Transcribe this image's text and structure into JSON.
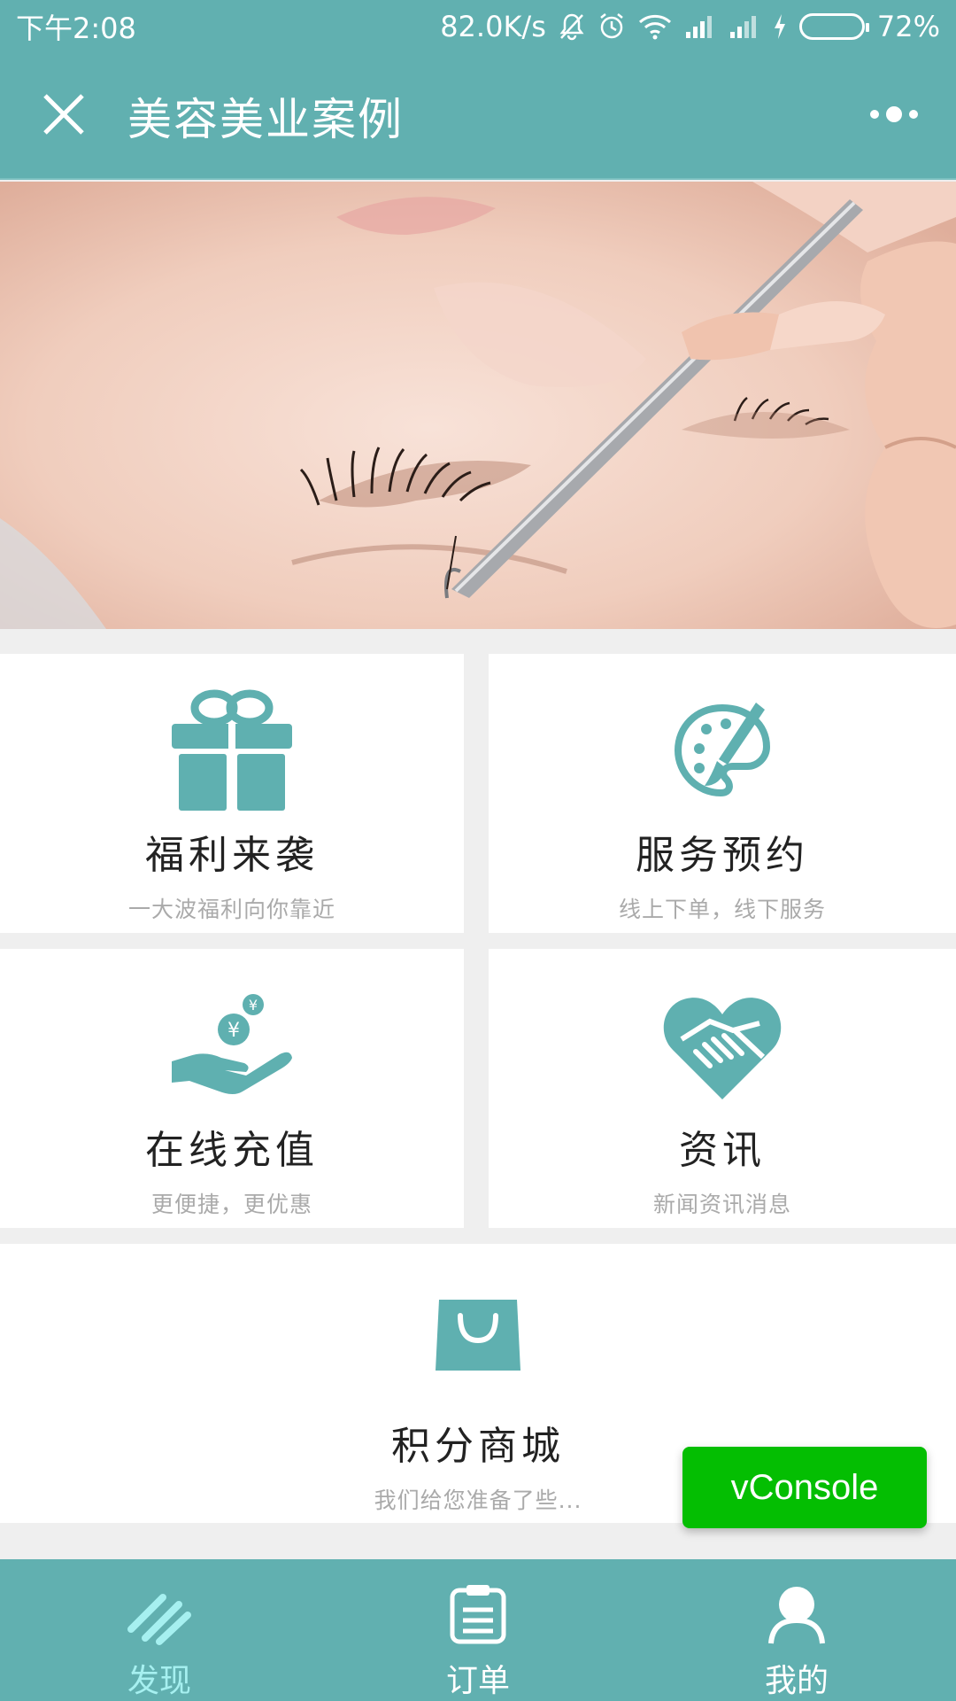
{
  "status_bar": {
    "time": "下午2:08",
    "speed": "82.0K/s",
    "battery": "72%",
    "battery_level": 0.72
  },
  "header": {
    "title": "美容美业案例",
    "close_icon": "close-icon",
    "more_icon": "more-icon"
  },
  "banner": {
    "icon": "eyelash-extension-photo"
  },
  "grid": [
    {
      "title": "福利来袭",
      "subtitle": "一大波福利向你靠近",
      "icon": "gift-icon"
    },
    {
      "title": "服务预约",
      "subtitle": "线上下单，线下服务",
      "icon": "palette-brush-icon"
    },
    {
      "title": "在线充值",
      "subtitle": "更便捷，更优惠",
      "icon": "hand-coins-icon"
    },
    {
      "title": "资讯",
      "subtitle": "新闻资讯消息",
      "icon": "heart-handshake-icon"
    },
    {
      "title": "积分商城",
      "subtitle": "我们给您准备了些...",
      "icon": "shopping-bag-icon"
    }
  ],
  "vconsole": {
    "label": "vConsole"
  },
  "tabbar": [
    {
      "label": "发现",
      "icon": "discover-icon",
      "active": true
    },
    {
      "label": "订单",
      "icon": "clipboard-icon",
      "active": false
    },
    {
      "label": "我的",
      "icon": "user-icon",
      "active": false
    }
  ],
  "colors": {
    "theme": "#61b0b0",
    "icon": "#5fb0b0",
    "tab_active": "#a6f0f0",
    "vconsole": "#04be02"
  }
}
